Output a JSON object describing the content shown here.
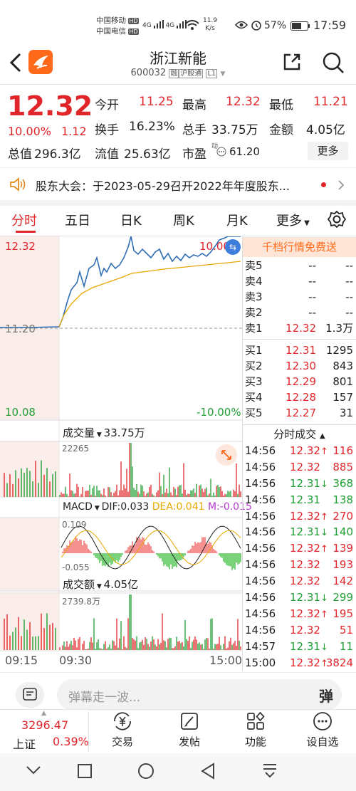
{
  "status": {
    "carrier1": "中国移动",
    "carrier2": "中国电信",
    "hd": "HD",
    "net1": "4G",
    "net2": "4G",
    "speed": "11.9",
    "speed_unit": "K/s",
    "battery": "57%",
    "time": "17:59"
  },
  "header": {
    "title": "浙江新能",
    "code": "600032",
    "tag1": "融",
    "tag2": "沪股通",
    "tag3": "L1"
  },
  "quote": {
    "price": "12.32",
    "pct": "10.00%",
    "chg": "1.12",
    "open_label": "今开",
    "open": "11.25",
    "high_label": "最高",
    "high": "12.32",
    "low_label": "最低",
    "low": "11.21",
    "turnover_label": "换手",
    "turnover": "16.23%",
    "vol_label": "总手",
    "vol": "33.75万",
    "amt_label": "金额",
    "amt": "4.05亿",
    "mcap_label": "总值",
    "mcap": "296.3亿",
    "float_label": "流值",
    "float": "25.63亿",
    "pe_label": "市盈",
    "pe_sup": "动",
    "pe": "61.20",
    "more": "更多"
  },
  "notice": "股东大会：于2023-05-29召开2022年年度股东...",
  "tabs": [
    "分时",
    "五日",
    "日K",
    "周K",
    "月K",
    "更多"
  ],
  "active_tab": 0,
  "chart": {
    "high": "12.32",
    "low": "10.08",
    "prev": "11.20",
    "pct_high": "10.00%",
    "pct_low": "-10.00%",
    "vol_label": "成交量",
    "vol_value": "33.75万",
    "vol_max": "22265",
    "macd_label": "MACD",
    "dif": "DIF:0.033",
    "dea": "DEA:0.041",
    "m": "M:-0.015",
    "macd_top": "0.109",
    "macd_bot": "-0.055",
    "amt_label": "成交额",
    "amt_value": "4.05亿",
    "amt_max": "2739.8万",
    "t1": "09:15",
    "t2": "09:30",
    "t3": "15:00"
  },
  "chart_data": {
    "type": "line",
    "x": [
      "09:30",
      "15:00"
    ],
    "ylim": [
      10.08,
      12.32
    ],
    "prev_close": 11.2,
    "series": []
  },
  "orderbook": {
    "banner": "千档行情免费送",
    "asks": [
      {
        "label": "卖5",
        "price": "--",
        "vol": "--"
      },
      {
        "label": "卖4",
        "price": "--",
        "vol": "--"
      },
      {
        "label": "卖3",
        "price": "--",
        "vol": "--"
      },
      {
        "label": "卖2",
        "price": "--",
        "vol": "--"
      },
      {
        "label": "卖1",
        "price": "12.32",
        "vol": "1.3万"
      }
    ],
    "bids": [
      {
        "label": "买1",
        "price": "12.31",
        "vol": "1295"
      },
      {
        "label": "买2",
        "price": "12.30",
        "vol": "843"
      },
      {
        "label": "买3",
        "price": "12.29",
        "vol": "801"
      },
      {
        "label": "买4",
        "price": "12.28",
        "vol": "157"
      },
      {
        "label": "买5",
        "price": "12.27",
        "vol": "31"
      }
    ],
    "trades_label": "分时成交",
    "trades": [
      {
        "t": "14:56",
        "p": "12.32",
        "dir": "↑",
        "v": "116",
        "c": "red"
      },
      {
        "t": "14:56",
        "p": "12.32",
        "dir": "",
        "v": "885",
        "c": "red"
      },
      {
        "t": "14:56",
        "p": "12.31",
        "dir": "↓",
        "v": "368",
        "c": "green"
      },
      {
        "t": "14:56",
        "p": "12.31",
        "dir": "",
        "v": "138",
        "c": "green"
      },
      {
        "t": "14:56",
        "p": "12.32",
        "dir": "↑",
        "v": "270",
        "c": "red"
      },
      {
        "t": "14:56",
        "p": "12.31",
        "dir": "↓",
        "v": "140",
        "c": "green"
      },
      {
        "t": "14:56",
        "p": "12.32",
        "dir": "↑",
        "v": "139",
        "c": "red"
      },
      {
        "t": "14:56",
        "p": "12.32",
        "dir": "",
        "v": "193",
        "c": "red"
      },
      {
        "t": "14:56",
        "p": "12.32",
        "dir": "",
        "v": "142",
        "c": "red"
      },
      {
        "t": "14:56",
        "p": "12.31",
        "dir": "↓",
        "v": "299",
        "c": "green"
      },
      {
        "t": "14:56",
        "p": "12.32",
        "dir": "↑",
        "v": "195",
        "c": "red"
      },
      {
        "t": "14:56",
        "p": "12.32",
        "dir": "",
        "v": "51",
        "c": "red"
      },
      {
        "t": "14:57",
        "p": "12.31",
        "dir": "↓",
        "v": "11",
        "c": "green"
      },
      {
        "t": "15:00",
        "p": "12.32",
        "dir": "↑",
        "v": "3824",
        "c": "red"
      }
    ]
  },
  "danmu": {
    "placeholder": "弹幕走一波...",
    "btn": "弹"
  },
  "bottom": {
    "index_name": "上证",
    "index_value": "3296.47",
    "index_pct": "0.39%",
    "trade": "交易",
    "post": "发帖",
    "func": "功能",
    "custom": "设自选"
  },
  "colors": {
    "up": "#e0262b",
    "down": "#1f9e34",
    "line": "#2f6db5",
    "avg": "#e8a800",
    "accent": "#ff6a1a"
  }
}
